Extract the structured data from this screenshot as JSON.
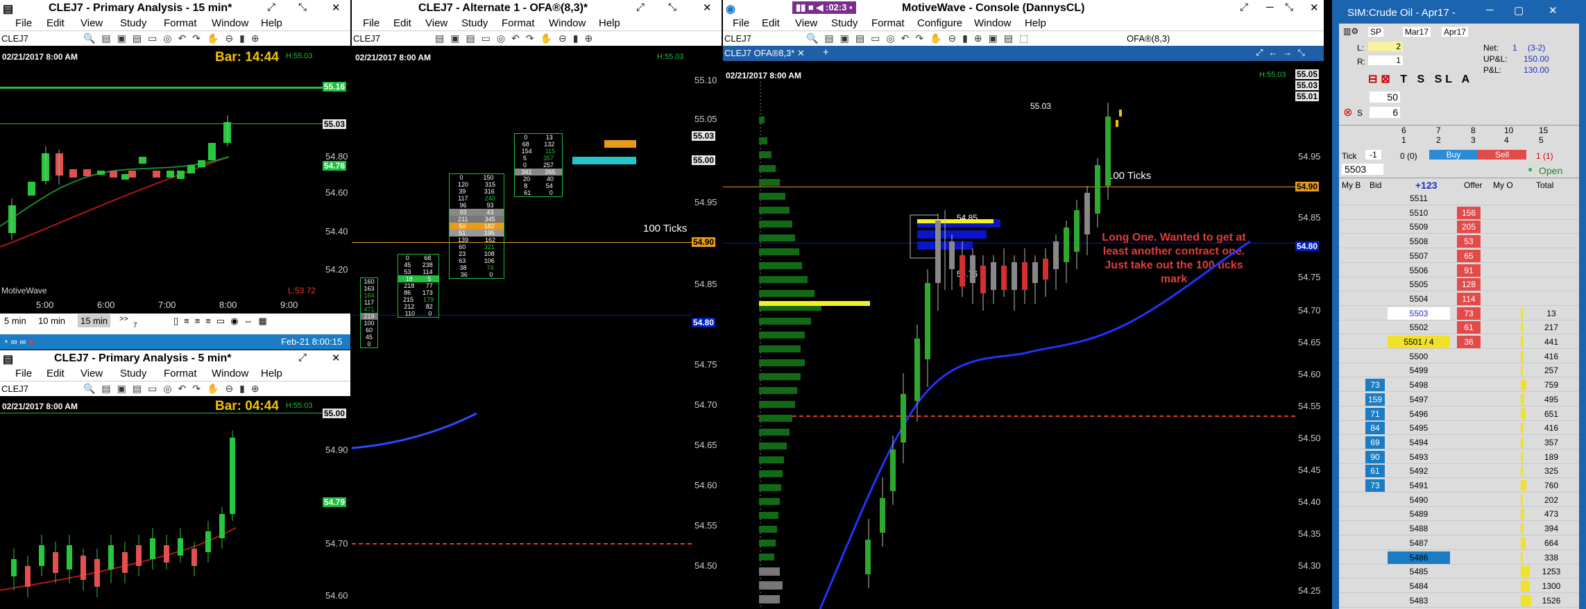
{
  "colors": {
    "green": "#1fbf3f",
    "red": "#e63b3b",
    "orange": "#e89b1a",
    "blue": "#0020b8"
  },
  "w1": {
    "title": "CLEJ7 - Primary Analysis - 15 min*",
    "menu": [
      "File",
      "Edit",
      "View",
      "Study",
      "Format",
      "Window",
      "Help"
    ],
    "symbol": "CLEJ7",
    "date": "02/21/2017 8:00 AM",
    "bar": "Bar: 14:44",
    "h": "H:55.03",
    "l": "L:53.72",
    "brand": "MotiveWave",
    "ticks": [
      "55.16",
      "55.03",
      "54.80",
      "54.76",
      "54.60",
      "54.40",
      "54.20"
    ],
    "times": [
      "5:00",
      "6:00",
      "7:00",
      "8:00",
      "9:00"
    ],
    "bottom": {
      "intervals": [
        "5 min",
        "10 min",
        "15 min"
      ],
      "more": ">>",
      "count": "7",
      "timestamp": "Feb-21 8:00:15"
    }
  },
  "w2": {
    "title": "CLEJ7 - Primary Analysis - 5 min*",
    "menu": [
      "File",
      "Edit",
      "View",
      "Study",
      "Format",
      "Window",
      "Help"
    ],
    "symbol": "CLEJ7",
    "date": "02/21/2017 8:00 AM",
    "bar": "Bar: 04:44",
    "h": "H:55.03",
    "ticks": [
      "55.00",
      "54.90",
      "54.79",
      "54.70",
      "54.60"
    ]
  },
  "w3": {
    "title": "CLEJ7 - Alternate 1 - OFA®(8,3)*",
    "menu": [
      "File",
      "Edit",
      "View",
      "Study",
      "Format",
      "Window",
      "Help"
    ],
    "symbol": "CLEJ7",
    "date": "02/21/2017 8:00 AM",
    "h": "H:55.03",
    "label": "100 Ticks",
    "ticks": [
      "55.10",
      "55.05",
      "55.03",
      "55.00",
      "54.95",
      "54.90",
      "54.85",
      "54.80",
      "54.75",
      "54.70",
      "54.65",
      "54.60",
      "54.55",
      "54.50"
    ],
    "fp1": [
      [
        "0",
        "68"
      ],
      [
        "45",
        "238"
      ],
      [
        "53",
        "114"
      ],
      [
        "18",
        "5"
      ],
      [
        "218",
        "77"
      ],
      [
        "86",
        "173"
      ],
      [
        "215",
        "179"
      ],
      [
        "212",
        "82"
      ],
      [
        "110",
        "0"
      ]
    ],
    "fp0": [
      [
        "160",
        "5"
      ],
      [
        "163",
        "0"
      ],
      [
        "164",
        "12"
      ],
      [
        "117",
        "36"
      ],
      [
        "471",
        "215"
      ],
      [
        "219",
        "35"
      ],
      [
        "100",
        ""
      ],
      [
        "60",
        ""
      ],
      [
        "45",
        ""
      ],
      [
        "0",
        ""
      ]
    ],
    "fp2": [
      [
        "0",
        "150"
      ],
      [
        "120",
        "315"
      ],
      [
        "39",
        "316"
      ],
      [
        "117",
        "240"
      ],
      [
        "96",
        "93"
      ],
      [
        "93",
        "43"
      ],
      [
        "211",
        "345"
      ],
      [
        "50",
        "182"
      ],
      [
        "51",
        "195"
      ],
      [
        "139",
        "162"
      ],
      [
        "60",
        "321"
      ],
      [
        "23",
        "108"
      ],
      [
        "63",
        "106"
      ],
      [
        "38",
        "74"
      ],
      [
        "36",
        "0"
      ]
    ],
    "fp3": [
      [
        "0",
        "13"
      ],
      [
        "68",
        "132"
      ],
      [
        "154",
        "115"
      ],
      [
        "5",
        "357"
      ],
      [
        "0",
        "257"
      ],
      [
        "341",
        "265"
      ],
      [
        "20",
        "40"
      ],
      [
        "8",
        "54"
      ],
      [
        "61",
        "0"
      ]
    ]
  },
  "w4": {
    "title": "MotiveWave - Console (DannysCL)",
    "timer": ":02:3",
    "menu": [
      "File",
      "Edit",
      "View",
      "Study",
      "Format",
      "Configure",
      "Window",
      "Help"
    ],
    "symbol": "CLEJ7",
    "study": "OFA®(8,3)",
    "tab": "CLEJ7 OFA®8,3*",
    "date": "02/21/2017 8:00 AM",
    "h": "H:55.03",
    "high_label": "55.03",
    "label100": "100 Ticks",
    "p1": "54.85",
    "p2": "54.76",
    "note": "Long One. Wanted to get at least another contract one. Just take out the 100 ticks mark",
    "ticks": [
      "55.05",
      "55.03",
      "55.01",
      "54.95",
      "54.90",
      "54.85",
      "54.80",
      "54.75",
      "54.70",
      "54.65",
      "54.60",
      "54.55",
      "54.50",
      "54.45",
      "54.40",
      "54.35",
      "54.30",
      "54.25"
    ]
  },
  "dom": {
    "title": "SIM:Crude Oil - Apr17 -",
    "acct": "SP",
    "m1": "Mar17",
    "m2": "Apr17",
    "l_label": "L:",
    "l_val": "2",
    "r_label": "R:",
    "r_val": "1",
    "net_label": "Net:",
    "net": "1",
    "net2": "(3-2)",
    "upl_label": "UP&L:",
    "upl": "150.00",
    "pl_label": "P&L:",
    "pl": "130.00",
    "qty": "50",
    "s_label": "S",
    "s_val": "6",
    "grid_top": [
      "6",
      "7",
      "8",
      "10",
      "15"
    ],
    "grid_bot": [
      "1",
      "2",
      "3",
      "4",
      "5"
    ],
    "tick_label": "Tick",
    "tick_val": "-1",
    "pos": "0 (0)",
    "buy": "Buy",
    "sell": "Sell",
    "sell_pos": "1 (1)",
    "price": "5503",
    "status": "Open",
    "headers": [
      "My B",
      "Bid",
      "+123",
      "Offer",
      "My O",
      "Total"
    ],
    "rows": [
      {
        "p": "5511",
        "bid": "",
        "off": "",
        "tot": ""
      },
      {
        "p": "5510",
        "bid": "",
        "off": "156",
        "tot": ""
      },
      {
        "p": "5509",
        "bid": "",
        "off": "205",
        "tot": ""
      },
      {
        "p": "5508",
        "bid": "",
        "off": "53",
        "tot": ""
      },
      {
        "p": "5507",
        "bid": "",
        "off": "65",
        "tot": ""
      },
      {
        "p": "5506",
        "bid": "",
        "off": "91",
        "tot": ""
      },
      {
        "p": "5505",
        "bid": "",
        "off": "128",
        "tot": ""
      },
      {
        "p": "5504",
        "bid": "",
        "off": "114",
        "tot": ""
      },
      {
        "p": "5503",
        "bid": "",
        "off": "73",
        "tot": "13"
      },
      {
        "p": "5502",
        "bid": "",
        "off": "61",
        "tot": "217"
      },
      {
        "p": "5501 / 4",
        "bid": "",
        "off": "36",
        "tot": "441"
      },
      {
        "p": "5500",
        "bid": "",
        "off": "",
        "tot": "416"
      },
      {
        "p": "5499",
        "bid": "",
        "off": "",
        "tot": "257"
      },
      {
        "p": "5498",
        "bid": "73",
        "off": "",
        "tot": "759"
      },
      {
        "p": "5497",
        "bid": "159",
        "off": "",
        "tot": "495"
      },
      {
        "p": "5496",
        "bid": "71",
        "off": "",
        "tot": "651"
      },
      {
        "p": "5495",
        "bid": "84",
        "off": "",
        "tot": "416"
      },
      {
        "p": "5494",
        "bid": "69",
        "off": "",
        "tot": "357"
      },
      {
        "p": "5493",
        "bid": "90",
        "off": "",
        "tot": "189"
      },
      {
        "p": "5492",
        "bid": "61",
        "off": "",
        "tot": "325"
      },
      {
        "p": "5491",
        "bid": "73",
        "off": "",
        "tot": "760"
      },
      {
        "p": "5490",
        "bid": "",
        "off": "",
        "tot": "202"
      },
      {
        "p": "5489",
        "bid": "",
        "off": "",
        "tot": "473"
      },
      {
        "p": "5488",
        "bid": "",
        "off": "",
        "tot": "394"
      },
      {
        "p": "5487",
        "bid": "",
        "off": "",
        "tot": "664"
      },
      {
        "p": "5486",
        "bid": "",
        "off": "",
        "tot": "338"
      },
      {
        "p": "5485",
        "bid": "",
        "off": "",
        "tot": "1253"
      },
      {
        "p": "5484",
        "bid": "",
        "off": "",
        "tot": "1300"
      },
      {
        "p": "5483",
        "bid": "",
        "off": "",
        "tot": "1526"
      }
    ]
  }
}
